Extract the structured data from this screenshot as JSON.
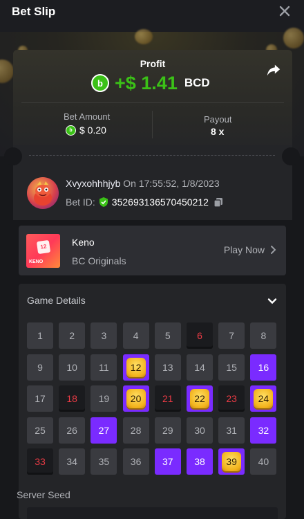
{
  "header": {
    "title": "Bet Slip"
  },
  "summary": {
    "profit_label": "Profit",
    "profit_value": "+$ 1.41",
    "profit_currency": "BCD",
    "bet_amount_label": "Bet Amount",
    "bet_amount_value": "$ 0.20",
    "payout_label": "Payout",
    "payout_value": "8 x"
  },
  "user": {
    "name": "Xvyxohhhjyb",
    "time": "On 17:55:52, 1/8/2023",
    "bet_id_label": "Bet ID:",
    "bet_id": "352693136570450212"
  },
  "game": {
    "name": "Keno",
    "provider": "BC Originals",
    "play_label": "Play Now",
    "thumb_number": "12",
    "thumb_text": "KENO"
  },
  "details": {
    "title": "Game Details",
    "grid": [
      {
        "n": "1",
        "s": "normal"
      },
      {
        "n": "2",
        "s": "normal"
      },
      {
        "n": "3",
        "s": "normal"
      },
      {
        "n": "4",
        "s": "normal"
      },
      {
        "n": "5",
        "s": "normal"
      },
      {
        "n": "6",
        "s": "miss"
      },
      {
        "n": "7",
        "s": "normal"
      },
      {
        "n": "8",
        "s": "normal"
      },
      {
        "n": "9",
        "s": "normal"
      },
      {
        "n": "10",
        "s": "normal"
      },
      {
        "n": "11",
        "s": "normal"
      },
      {
        "n": "12",
        "s": "hit"
      },
      {
        "n": "13",
        "s": "normal"
      },
      {
        "n": "14",
        "s": "normal"
      },
      {
        "n": "15",
        "s": "normal"
      },
      {
        "n": "16",
        "s": "picked"
      },
      {
        "n": "17",
        "s": "normal"
      },
      {
        "n": "18",
        "s": "miss"
      },
      {
        "n": "19",
        "s": "normal"
      },
      {
        "n": "20",
        "s": "hit"
      },
      {
        "n": "21",
        "s": "miss"
      },
      {
        "n": "22",
        "s": "hit"
      },
      {
        "n": "23",
        "s": "miss"
      },
      {
        "n": "24",
        "s": "hit"
      },
      {
        "n": "25",
        "s": "normal"
      },
      {
        "n": "26",
        "s": "normal"
      },
      {
        "n": "27",
        "s": "picked"
      },
      {
        "n": "28",
        "s": "normal"
      },
      {
        "n": "29",
        "s": "normal"
      },
      {
        "n": "30",
        "s": "normal"
      },
      {
        "n": "31",
        "s": "normal"
      },
      {
        "n": "32",
        "s": "picked"
      },
      {
        "n": "33",
        "s": "miss"
      },
      {
        "n": "34",
        "s": "normal"
      },
      {
        "n": "35",
        "s": "normal"
      },
      {
        "n": "36",
        "s": "normal"
      },
      {
        "n": "37",
        "s": "picked"
      },
      {
        "n": "38",
        "s": "picked"
      },
      {
        "n": "39",
        "s": "hit"
      },
      {
        "n": "40",
        "s": "normal"
      }
    ],
    "server_seed_label": "Server Seed"
  },
  "colors": {
    "profit_green": "#3bc117",
    "picked_purple": "#7a2bff",
    "miss_red": "#ec3b45",
    "hit_gold": "#f2b21b"
  }
}
